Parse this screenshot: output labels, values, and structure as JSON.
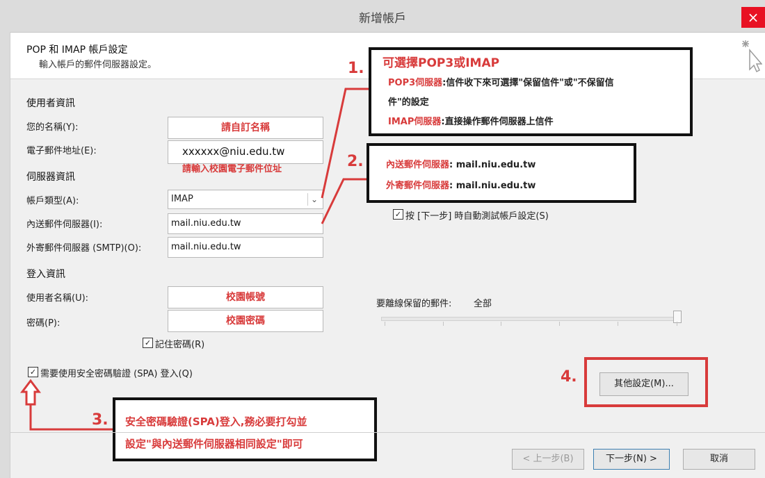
{
  "window": {
    "title": "新增帳戶",
    "close_glyph": "×"
  },
  "header": {
    "title": "POP 和 IMAP 帳戶設定",
    "subtitle": "輸入帳戶的郵件伺服器設定。"
  },
  "user_info": {
    "section": "使用者資訊",
    "name_label": "您的名稱(Y):",
    "name_value": "請自訂名稱",
    "email_label": "電子郵件地址(E):",
    "email_value": "xxxxxx@niu.edu.tw",
    "email_note": "請輸入校園電子郵件位址"
  },
  "server_info": {
    "section": "伺服器資訊",
    "account_type_label": "帳戶類型(A):",
    "account_type_value": "IMAP",
    "incoming_label": "內送郵件伺服器(I):",
    "incoming_value": "mail.niu.edu.tw",
    "outgoing_label": "外寄郵件伺服器 (SMTP)(O):",
    "outgoing_value": "mail.niu.edu.tw"
  },
  "login_info": {
    "section": "登入資訊",
    "username_label": "使用者名稱(U):",
    "username_value": "校園帳號",
    "password_label": "密碼(P):",
    "password_value": "校園密碼",
    "remember_label": "記住密碼(R)",
    "spa_label": "需要使用安全密碼驗證 (SPA) 登入(Q)"
  },
  "right_panel": {
    "auto_test_label": "按 [下一步] 時自動測試帳戶設定(S)",
    "offline_label": "要離線保留的郵件:",
    "offline_value": "全部",
    "more_settings": "其他設定(M)..."
  },
  "annotations": {
    "n1": "1.",
    "a1_title": "可選擇POP3或IMAP",
    "a1_pop_key": "POP3伺服器",
    "a1_pop_text_1": ":信件收下來可選擇\"保留信件\"或\"不保留信",
    "a1_pop_text_2": "件\"的設定",
    "a1_imap_key": "IMAP伺服器",
    "a1_imap_text": ":直接操作郵件伺服器上信件",
    "n2": "2.",
    "a2_in_key": "內送郵件伺服器",
    "a2_in_val": ": mail.niu.edu.tw",
    "a2_out_key": "外寄郵件伺服器",
    "a2_out_val": ": mail.niu.edu.tw",
    "n3": "3.",
    "a3_line1": "安全密碼驗證(SPA)登入,務必要打勾並",
    "a3_line2": "設定\"與內送郵件伺服器相同設定\"即可",
    "n4": "4."
  },
  "footer": {
    "back": "< 上一步(B)",
    "next": "下一步(N) >",
    "cancel": "取消"
  },
  "colors": {
    "accent_red": "#d83b3b",
    "close_red": "#e81123"
  }
}
